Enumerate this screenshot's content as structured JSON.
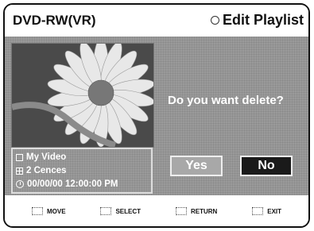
{
  "header": {
    "left_title": "DVD-RW(VR)",
    "right_title": "Edit Playlist"
  },
  "info": {
    "title": "My Video",
    "scenes": "2 Cences",
    "datetime": "00/00/00 12:00:00  PM"
  },
  "dialog": {
    "question": "Do you want delete?",
    "yes_label": "Yes",
    "no_label": "No"
  },
  "footer": {
    "move": "MOVE",
    "select": "SELECT",
    "return": "RETURN",
    "exit": "EXIT"
  },
  "colors": {
    "panel": "#9a9a9a",
    "no_button": "#1a1a1a",
    "yes_button": "#a8a8a8"
  }
}
